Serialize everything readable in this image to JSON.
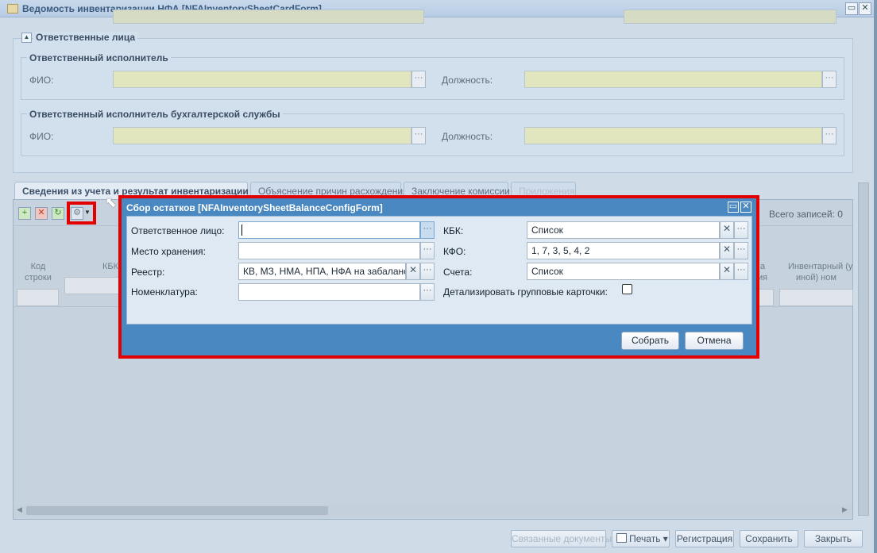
{
  "window": {
    "title": "Ведомость инвентаризации НФА [NFAInventorySheetCardForm]"
  },
  "responsible": {
    "legend": "Ответственные лица",
    "executor": {
      "legend": "Ответственный исполнитель",
      "fio_label": "ФИО:",
      "position_label": "Должность:"
    },
    "accountant": {
      "legend": "Ответственный исполнитель бухгалтерской службы",
      "fio_label": "ФИО:",
      "position_label": "Должность:"
    }
  },
  "tabs": [
    {
      "label": "Сведения из учета и результат инвентаризации"
    },
    {
      "label": "Объяснение причин расхождения"
    },
    {
      "label": "Заключение комиссии"
    },
    {
      "label": "Приложения"
    }
  ],
  "grid": {
    "total_records": "Всего записей: 0",
    "columns": {
      "code_line1": "Код",
      "code_line2": "строки",
      "kbk": "КБК",
      "inv_line1": "Инвентарный (у",
      "inv_line2": "иной) ном",
      "partial_line1": "а",
      "partial_line2": "ия"
    }
  },
  "footer": {
    "linked_docs": "Связанные документы",
    "print": "Печать",
    "registration": "Регистрация",
    "save": "Сохранить",
    "close": "Закрыть"
  },
  "dialog": {
    "title": "Сбор остатков [NFAInventorySheetBalanceConfigForm]",
    "fields": {
      "responsible": {
        "label": "Ответственное лицо:",
        "value": ""
      },
      "storage": {
        "label": "Место хранения:",
        "value": ""
      },
      "registry": {
        "label": "Реестр:",
        "value": "КВ, МЗ, НМА, НПА, НФА на забалансовых счетах"
      },
      "nomenclature": {
        "label": "Номенклатура:",
        "value": ""
      },
      "kbk": {
        "label": "КБК:",
        "value": "Список"
      },
      "kfo": {
        "label": "КФО:",
        "value": "1, 7, 3, 5, 4, 2"
      },
      "accounts": {
        "label": "Счета:",
        "value": "Список"
      },
      "detail": {
        "label": "Детализировать групповые карточки:",
        "checked": false
      }
    },
    "buttons": {
      "collect": "Собрать",
      "cancel": "Отмена"
    }
  }
}
